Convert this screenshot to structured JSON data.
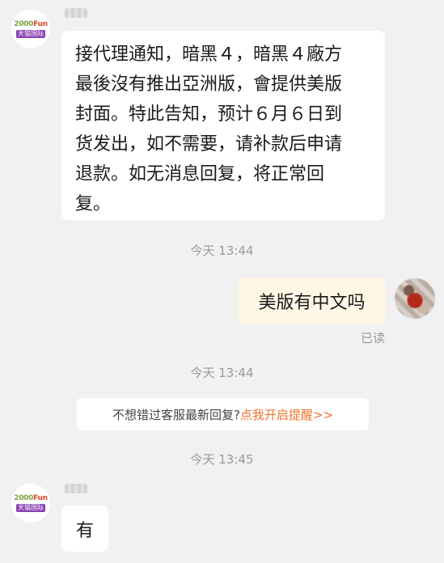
{
  "messages": [
    {
      "from": "shop",
      "avatar_logo_top": "2000Fun",
      "avatar_logo_bottom": "天猫国际",
      "text": "接代理通知，暗黑４，暗黑４廠方\n最後沒有推出亞洲版，會提供美版\n封面。特此告知，预计６月６日到\n货发出，如不需要，请补款后申请\n退款。如无消息回复，将正常回\n复。"
    },
    {
      "timestamp": "今天 13:44"
    },
    {
      "from": "user",
      "text": "美版有中文吗",
      "status": "已读"
    },
    {
      "timestamp": "今天 13:44"
    },
    {
      "notice": {
        "text": "不想错过客服最新回复?",
        "link": "点我开启提醒>>"
      }
    },
    {
      "timestamp": "今天 13:45"
    },
    {
      "from": "shop",
      "avatar_logo_top": "2000Fun",
      "avatar_logo_bottom": "天猫国际",
      "text": "有"
    }
  ]
}
